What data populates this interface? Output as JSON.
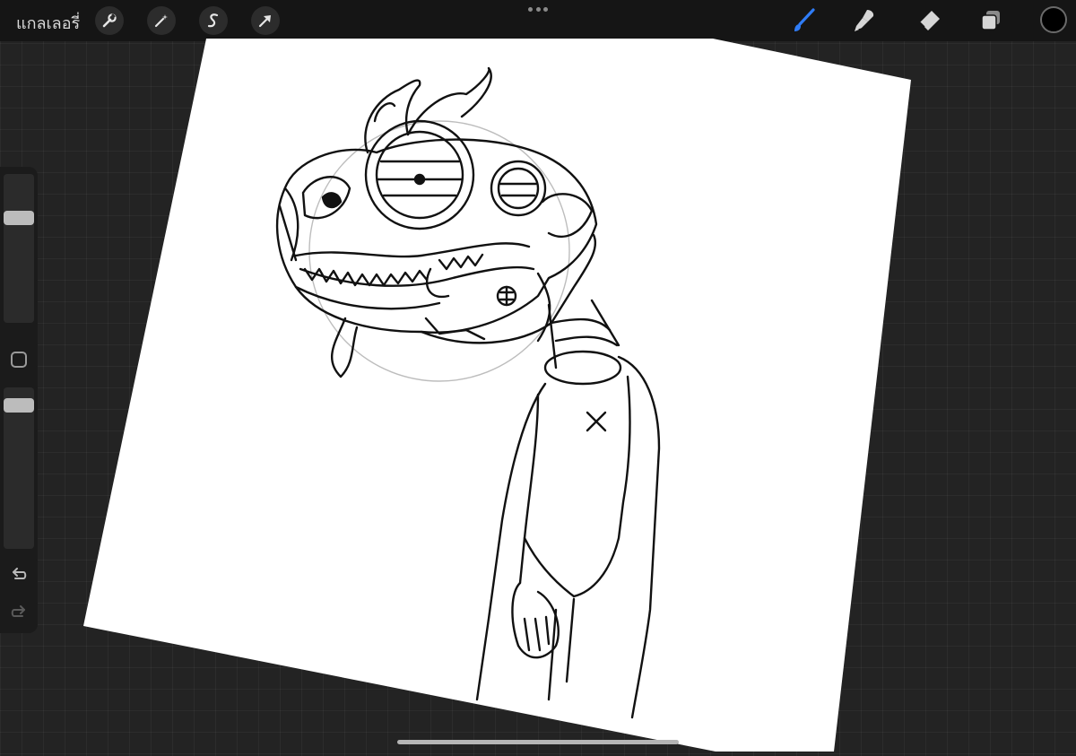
{
  "topbar": {
    "gallery_label": "แกลเลอรี่",
    "left_tools": [
      {
        "name": "actions",
        "icon": "wrench-icon"
      },
      {
        "name": "adjustments",
        "icon": "magic-wand-icon"
      },
      {
        "name": "selection",
        "icon": "selection-s-icon"
      },
      {
        "name": "transform",
        "icon": "arrow-cursor-icon"
      }
    ],
    "more_icon": "more-dots-icon",
    "right_tools": [
      {
        "name": "brush",
        "icon": "brush-icon",
        "active": true
      },
      {
        "name": "smudge",
        "icon": "smudge-icon",
        "active": false
      },
      {
        "name": "eraser",
        "icon": "eraser-icon",
        "active": false
      },
      {
        "name": "layers",
        "icon": "layers-icon",
        "active": false
      }
    ],
    "current_color": "#000000"
  },
  "sidebar": {
    "brush_size": 0.75,
    "brush_opacity": 0.95,
    "modify_icon": "square-modify-icon",
    "undo_icon": "undo-icon",
    "redo_icon": "redo-icon"
  },
  "colors": {
    "accent_blue": "#2f7cf6",
    "canvas_bg": "#ffffff",
    "workspace_bg": "#232323"
  }
}
